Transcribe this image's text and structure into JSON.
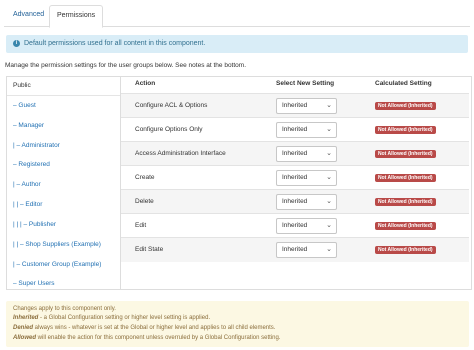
{
  "tabs": [
    {
      "label": "Advanced"
    },
    {
      "label": "Permissions"
    }
  ],
  "info": {
    "icon": "info-icon",
    "text": "Default permissions used for all content in this component."
  },
  "manage_text": "Manage the permission settings for the user groups below. See notes at the bottom.",
  "groups": [
    {
      "label": "Public"
    },
    {
      "label": "– Guest"
    },
    {
      "label": "– Manager"
    },
    {
      "label": "|  – Administrator"
    },
    {
      "label": "– Registered"
    },
    {
      "label": "|  – Author"
    },
    {
      "label": "|  |  – Editor"
    },
    {
      "label": "|  |  |  – Publisher"
    },
    {
      "label": "|  |  – Shop Suppliers (Example)"
    },
    {
      "label": "|  – Customer Group (Example)"
    },
    {
      "label": "– Super Users"
    }
  ],
  "table": {
    "headers": {
      "action": "Action",
      "setting": "Select New Setting",
      "calculated": "Calculated Setting"
    },
    "rows": [
      {
        "action": "Configure ACL & Options",
        "setting": "Inherited",
        "calculated": "Not Allowed (Inherited)"
      },
      {
        "action": "Configure Options Only",
        "setting": "Inherited",
        "calculated": "Not Allowed (Inherited)"
      },
      {
        "action": "Access Administration Interface",
        "setting": "Inherited",
        "calculated": "Not Allowed (Inherited)"
      },
      {
        "action": "Create",
        "setting": "Inherited",
        "calculated": "Not Allowed (Inherited)"
      },
      {
        "action": "Delete",
        "setting": "Inherited",
        "calculated": "Not Allowed (Inherited)"
      },
      {
        "action": "Edit",
        "setting": "Inherited",
        "calculated": "Not Allowed (Inherited)"
      },
      {
        "action": "Edit State",
        "setting": "Inherited",
        "calculated": "Not Allowed (Inherited)"
      }
    ]
  },
  "notes": {
    "line1": "Changes apply to this component only.",
    "line2_em": "Inherited",
    "line2": " - a Global Configuration setting or higher level setting is applied.",
    "line3_em": "Denied",
    "line3": " always wins - whatever is set at the Global or higher level and applies to all child elements.",
    "line4_em": "Allowed",
    "line4": " will enable the action for this component unless overruled by a Global Configuration setting."
  }
}
